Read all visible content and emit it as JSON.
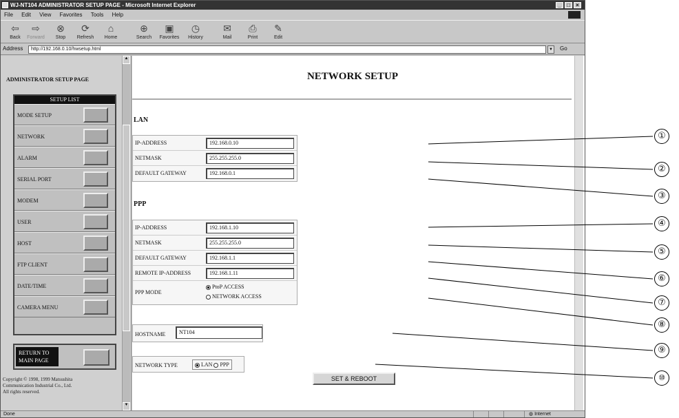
{
  "window": {
    "title": "WJ-NT104 ADMINISTRATOR SETUP PAGE - Microsoft Internet Explorer"
  },
  "menu": [
    "File",
    "Edit",
    "View",
    "Favorites",
    "Tools",
    "Help"
  ],
  "toolbar": {
    "back": "Back",
    "forward": "Forward",
    "stop": "Stop",
    "refresh": "Refresh",
    "home": "Home",
    "search": "Search",
    "favorites": "Favorites",
    "history": "History",
    "mail": "Mail",
    "print": "Print",
    "edit": "Edit"
  },
  "address": {
    "label": "Address",
    "value": "http://192.168.0.10/hwsetup.html",
    "go": "Go"
  },
  "sidebar": {
    "title": "ADMINISTRATOR SETUP PAGE",
    "list_header": "SETUP LIST",
    "items": [
      {
        "label": "MODE SETUP"
      },
      {
        "label": "NETWORK"
      },
      {
        "label": "ALARM"
      },
      {
        "label": "SERIAL PORT"
      },
      {
        "label": "MODEM"
      },
      {
        "label": "USER"
      },
      {
        "label": "HOST"
      },
      {
        "label": "FTP CLIENT"
      },
      {
        "label": "DATE/TIME"
      },
      {
        "label": "CAMERA MENU"
      }
    ],
    "return_label_1": "RETURN TO",
    "return_label_2": "MAIN PAGE",
    "copyright_1": "Copyright © 1998, 1999 Matsushita",
    "copyright_2": "Communication Industrial Co., Ltd.",
    "copyright_3": "All rights reserved."
  },
  "main": {
    "title": "NETWORK SETUP",
    "lan": {
      "heading": "LAN",
      "ip_label": "IP-ADDRESS",
      "ip": "192.168.0.10",
      "mask_label": "NETMASK",
      "mask": "255.255.255.0",
      "gw_label": "DEFAULT GATEWAY",
      "gw": "192.168.0.1"
    },
    "ppp": {
      "heading": "PPP",
      "ip_label": "IP-ADDRESS",
      "ip": "192.168.1.10",
      "mask_label": "NETMASK",
      "mask": "255.255.255.0",
      "gw_label": "DEFAULT GATEWAY",
      "gw": "192.168.1.1",
      "remote_label": "REMOTE IP-ADDRESS",
      "remote": "192.168.1.11",
      "mode_label": "PPP MODE",
      "mode_opt1": "PtoP ACCESS",
      "mode_opt2": "NETWORK ACCESS",
      "mode_selected": "PtoP ACCESS"
    },
    "hostname_label": "HOSTNAME",
    "hostname": "NT104",
    "network_type_label": "NETWORK TYPE",
    "type_opt1": "LAN",
    "type_opt2": "PPP",
    "type_selected": "LAN",
    "reboot_button": "SET & REBOOT"
  },
  "status": {
    "left": "Done",
    "zone": "Internet"
  },
  "callouts": [
    "①",
    "②",
    "③",
    "④",
    "⑤",
    "⑥",
    "⑦",
    "⑧",
    "⑨",
    "⑩"
  ]
}
